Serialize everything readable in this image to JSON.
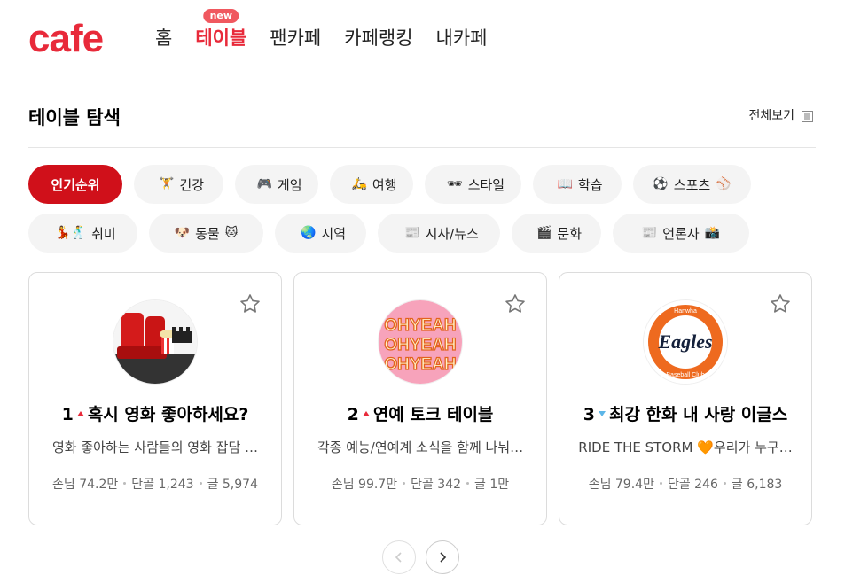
{
  "brand": {
    "logo": "cafe",
    "color": "#e82a3a"
  },
  "nav": {
    "items": [
      {
        "label": "홈"
      },
      {
        "label": "테이블",
        "badge": "new",
        "active": true
      },
      {
        "label": "팬카페"
      },
      {
        "label": "카페랭킹"
      },
      {
        "label": "내카페"
      }
    ]
  },
  "section": {
    "title": "테이블 탐색",
    "view_all": "전체보기"
  },
  "chips": {
    "row1": [
      {
        "label": "인기순위",
        "active": true
      },
      {
        "pre": "🏋",
        "label": "건강"
      },
      {
        "pre": "🎮",
        "label": "게임"
      },
      {
        "pre": "🛵",
        "label": "여행"
      },
      {
        "pre": "🕶",
        "label": "스타일"
      },
      {
        "pre": "📖",
        "label": "학습"
      },
      {
        "pre": "⚽",
        "label": "스포츠",
        "post": "⚾"
      }
    ],
    "row2": [
      {
        "pre": "💃🕺",
        "label": "취미"
      },
      {
        "pre": "🐶",
        "label": "동물",
        "post": "🐱"
      },
      {
        "pre": "🌏",
        "label": "지역"
      },
      {
        "pre": "📰",
        "label": "시사/뉴스"
      },
      {
        "pre": "🎬",
        "label": "문화"
      },
      {
        "pre": "📰",
        "label": "언론사",
        "post": "📸"
      }
    ]
  },
  "cards": [
    {
      "rank": "1",
      "trend": "up",
      "title": "혹시 영화 좋아하세요?",
      "desc": "영화 좋아하는 사람들의 영화 잡담 …",
      "visitors": "손님 74.2만",
      "regulars": "단골 1,243",
      "posts": "글 5,974"
    },
    {
      "rank": "2",
      "trend": "up",
      "title": "연예 토크 테이블",
      "desc": "각종 예능/연예계 소식을 함께 나눠…",
      "visitors": "손님 99.7만",
      "regulars": "단골 342",
      "posts": "글 1만",
      "thumb_text": "OHYEAH"
    },
    {
      "rank": "3",
      "trend": "down",
      "title": "최강 한화 내 사랑 이글스",
      "desc": "RIDE THE STORM 🧡우리가 누구…",
      "visitors": "손님 79.4만",
      "regulars": "단골 246",
      "posts": "글 6,183",
      "thumb_text": "Eagles",
      "thumb_ring_top": "Hanwha",
      "thumb_ring_bottom": "Baseball Club"
    }
  ],
  "pager": {
    "prev": "prev",
    "next": "next"
  }
}
